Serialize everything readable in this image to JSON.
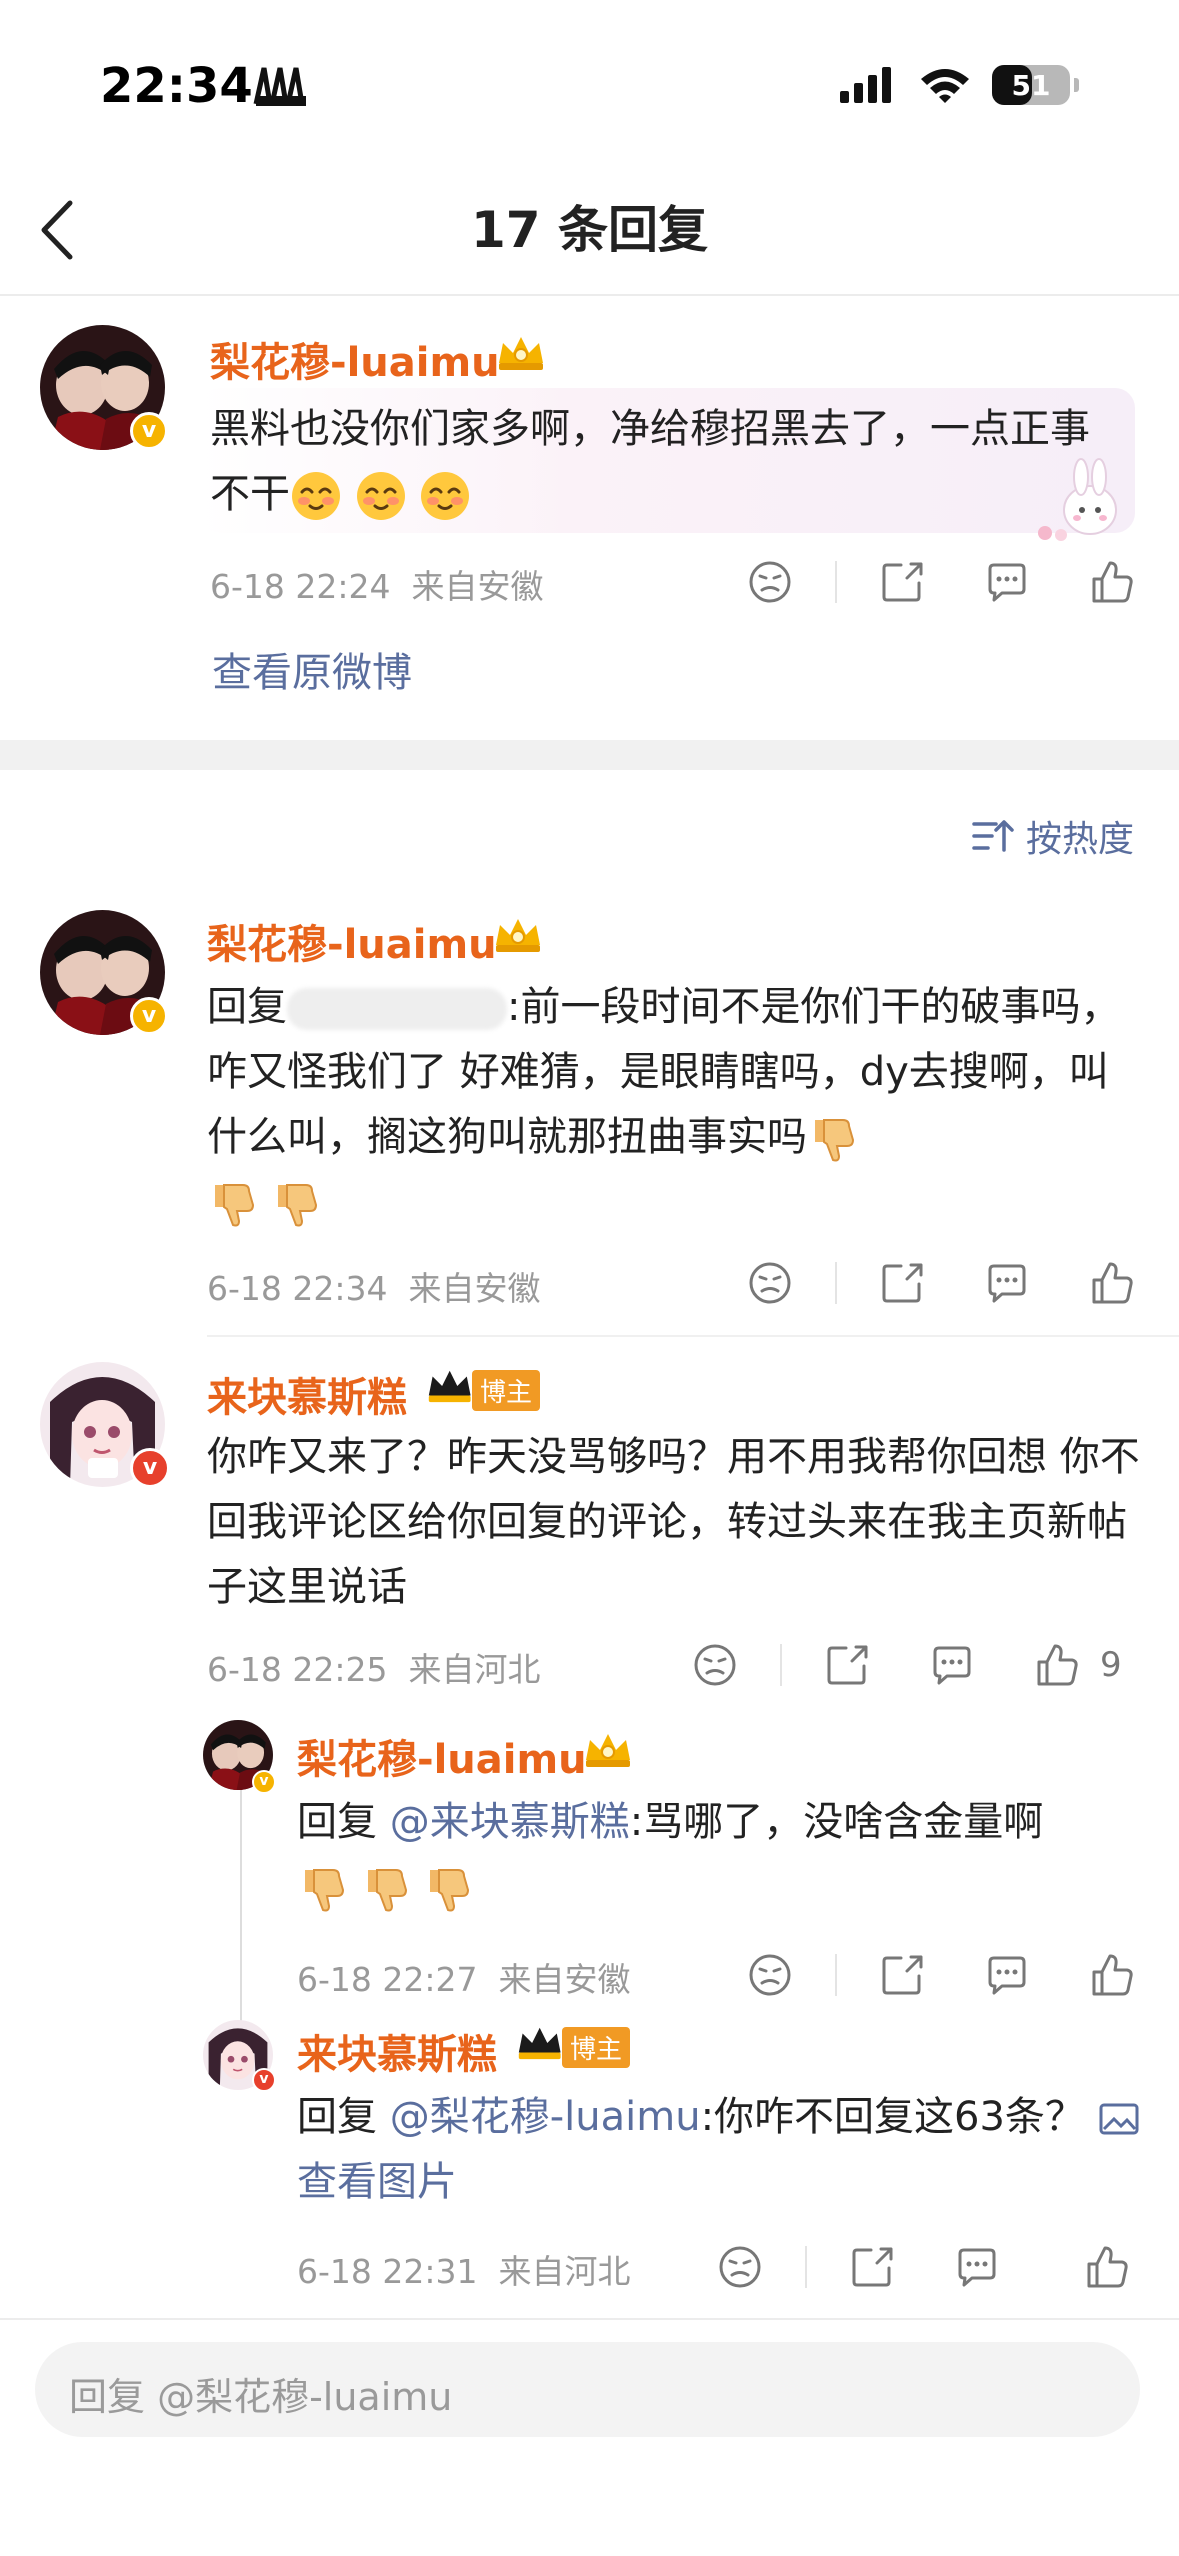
{
  "status_bar": {
    "time": "22:34",
    "battery_level": "51",
    "battery_fraction": 0.51
  },
  "header": {
    "title": "17 条回复"
  },
  "original_comment": {
    "username": "梨花穆-luaimu",
    "text": "黑料也没你们家多啊，净给穆招黑去了，一点正事不干",
    "emojis": [
      "smile-emoji",
      "smile-emoji",
      "smile-emoji"
    ],
    "time": "6-18 22:24",
    "location": "来自安徽",
    "view_original": "查看原微博"
  },
  "sort": {
    "label": "按热度"
  },
  "comments": [
    {
      "username": "梨花穆-luaimu",
      "reply_prefix": "回复",
      "text": ":前一段时间不是你们干的破事吗，咋又怪我们了 好难猜，是眼睛瞎吗，dy去搜啊，叫什么叫，搁这狗叫就那扭曲事实吗",
      "time": "6-18 22:34",
      "location": "来自安徽"
    },
    {
      "username": "来块慕斯糕",
      "badge": "博主",
      "text": "你咋又来了？昨天没骂够吗？用不用我帮你回想 你不回我评论区给你回复的评论，转过头来在我主页新帖子这里说话",
      "time": "6-18 22:25",
      "location": "来自河北",
      "likes": "9",
      "replies": [
        {
          "username": "梨花穆-luaimu",
          "reply_prefix": "回复",
          "mention": "@来块慕斯糕",
          "text": ":骂哪了，没啥含金量啊",
          "time": "6-18 22:27",
          "location": "来自安徽"
        },
        {
          "username": "来块慕斯糕",
          "badge": "博主",
          "reply_prefix": "回复",
          "mention": "@梨花穆-luaimu",
          "text": ":你咋不回复这63条？",
          "view_image": "查看图片",
          "time": "6-18 22:31",
          "location": "来自河北"
        }
      ]
    }
  ],
  "reply_input": {
    "placeholder": "回复 @梨花穆-luaimu"
  },
  "colors": {
    "username": "#e8641b",
    "link": "#5a6e9e",
    "meta": "#999999",
    "vip": "#f6b300",
    "host": "#f19a24"
  }
}
